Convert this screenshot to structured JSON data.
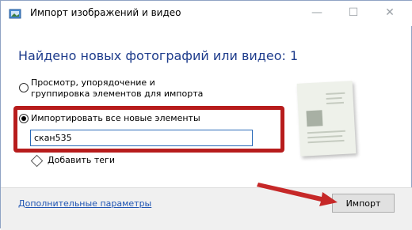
{
  "window": {
    "title": "Импорт изображений и видео"
  },
  "titlebar_buttons": {
    "minimize": "—",
    "maximize": "☐",
    "close": "✕"
  },
  "main": {
    "heading": "Найдено новых фотографий или видео: 1",
    "option_review": "Просмотр, упорядочение и группировка элементов для импорта",
    "option_import_all": "Импортировать все новые элементы",
    "name_field_value": "скан535",
    "add_tags_label": "Добавить теги"
  },
  "footer": {
    "more_options_link": "Дополнительные параметры",
    "import_button": "Импорт"
  },
  "colors": {
    "accent": "#1e3c8c",
    "annotation": "#b71c1c",
    "link": "#1f55b3"
  }
}
